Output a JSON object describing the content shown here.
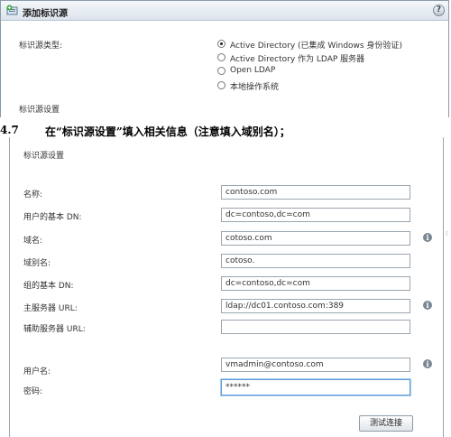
{
  "dialog": {
    "title": "添加标识源",
    "help": "?",
    "identity_source_type_label": "标识源类型:",
    "radio_options": [
      {
        "label": "Active Directory (已集成 Windows 身份验证)",
        "selected": true
      },
      {
        "label": "Active Directory 作为 LDAP 服务器",
        "selected": false
      },
      {
        "label": "Open LDAP",
        "selected": false
      },
      {
        "label": "本地操作系统",
        "selected": false
      }
    ],
    "settings_label": "标识源设置"
  },
  "heading": {
    "number": "4.7",
    "text": "在“标识源设置”填入相关信息（注意填入域别名）；"
  },
  "form": {
    "section_label": "标识源设置",
    "fields": [
      {
        "label": "名称:",
        "value": "contoso.com"
      },
      {
        "label": "用户的基本 DN:",
        "value": "dc=contoso,dc=com"
      },
      {
        "label": "域名:",
        "value": "cotoso.com"
      },
      {
        "label": "域别名:",
        "value": "cotoso."
      },
      {
        "label": "组的基本 DN:",
        "value": "dc=contoso,dc=com"
      },
      {
        "label": "主服务器 URL:",
        "value": "ldap://dc01.contoso.com:389"
      },
      {
        "label": "辅助服务器 URL:",
        "value": ""
      },
      {
        "label": "用户名:",
        "value": "vmadmin@contoso.com"
      },
      {
        "label": "密码:",
        "value": "******"
      }
    ],
    "info_glyph": "i",
    "test_button": "测试连接"
  },
  "colors": {
    "focus_border": "#5b9bd5",
    "info_icon": "#7b8794",
    "title_bar": "#dce4ec"
  }
}
